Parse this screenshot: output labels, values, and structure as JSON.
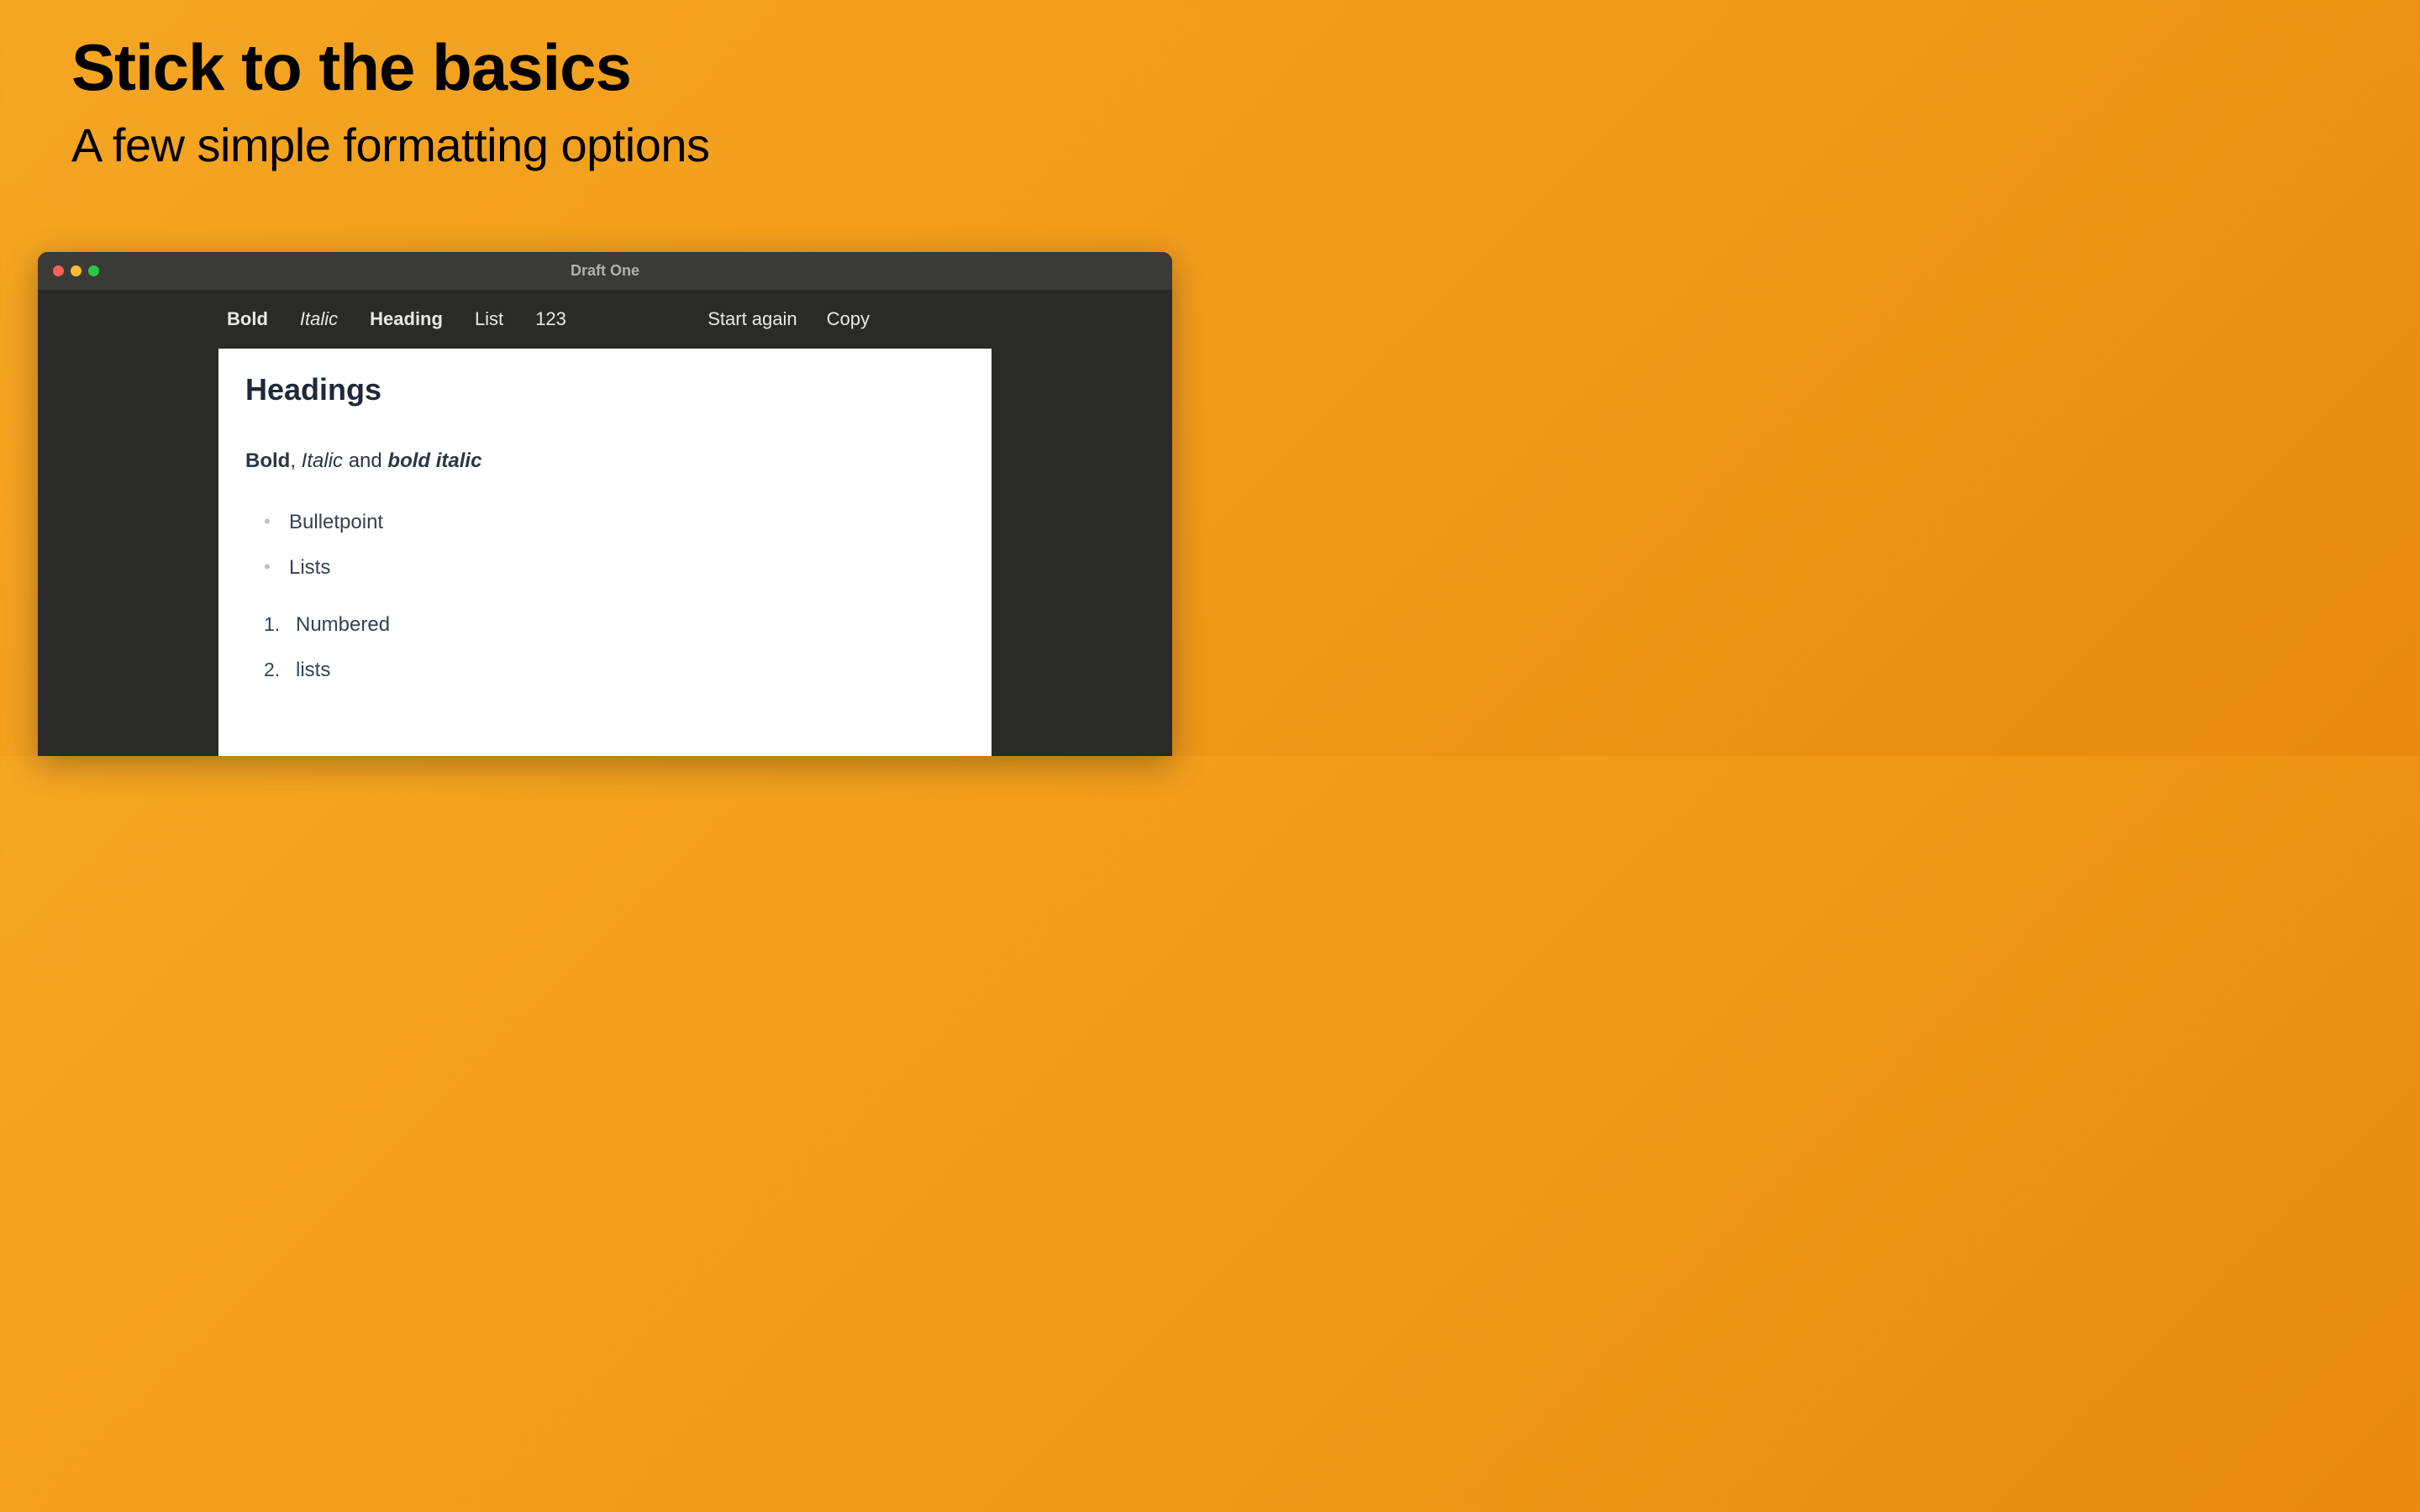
{
  "promo": {
    "heading": "Stick to the basics",
    "subheading": "A few simple formatting options"
  },
  "window": {
    "title": "Draft One"
  },
  "toolbar": {
    "bold": "Bold",
    "italic": "Italic",
    "heading": "Heading",
    "list": "List",
    "numbered": "123",
    "start_again": "Start again",
    "copy": "Copy"
  },
  "document": {
    "heading": "Headings",
    "format_bold": "Bold",
    "format_comma": ", ",
    "format_italic": "Italic",
    "format_and": " and ",
    "format_bold_italic": "bold italic",
    "bullets": [
      "Bulletpoint",
      "Lists"
    ],
    "numbered": [
      "Numbered",
      "lists"
    ]
  }
}
